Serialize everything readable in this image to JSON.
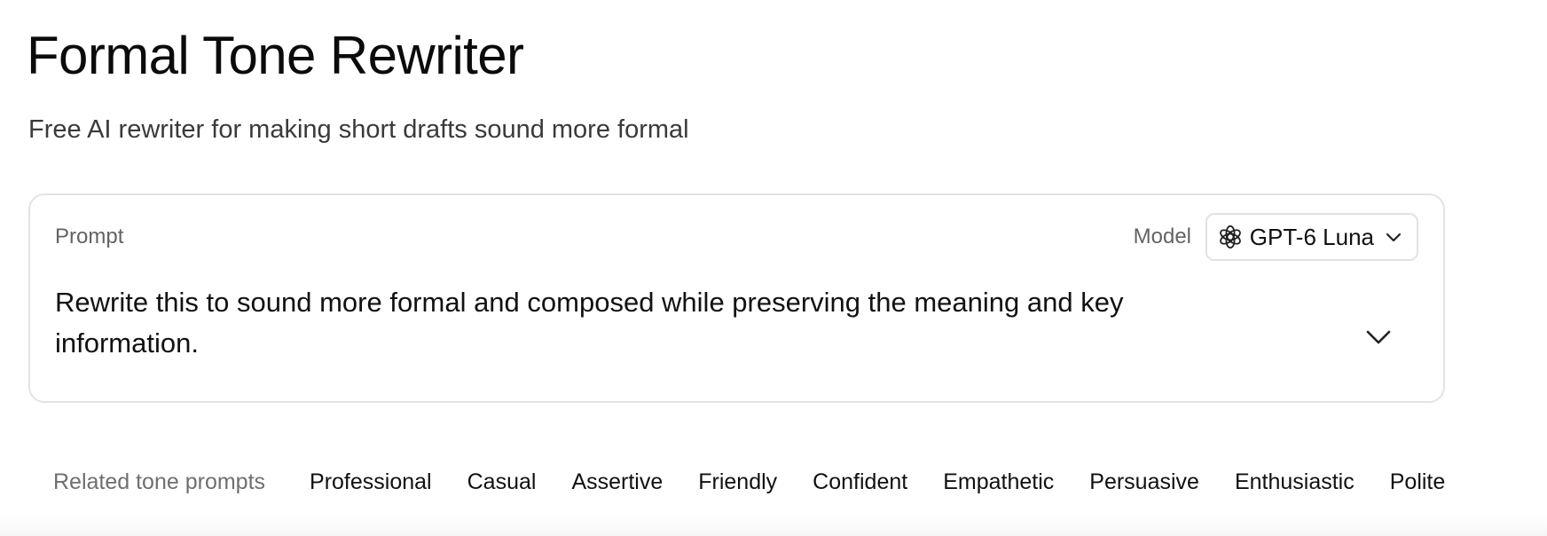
{
  "page": {
    "title": "Formal Tone Rewriter",
    "subtitle": "Free AI rewriter for making short drafts sound more formal"
  },
  "prompt_card": {
    "label": "Prompt",
    "model_label": "Model",
    "model_value": "GPT-6 Luna",
    "model_icon": "openai-logo-icon",
    "text": "Rewrite this to sound more formal and composed while preserving the meaning and key information.",
    "expand_icon": "chevron-down-icon"
  },
  "related": {
    "label": "Related tone prompts",
    "items": [
      "Professional",
      "Casual",
      "Assertive",
      "Friendly",
      "Confident",
      "Empathetic",
      "Persuasive",
      "Enthusiastic",
      "Polite"
    ]
  },
  "colors": {
    "border": "#e3e3e3",
    "muted_text": "#636363",
    "text": "#111111"
  }
}
